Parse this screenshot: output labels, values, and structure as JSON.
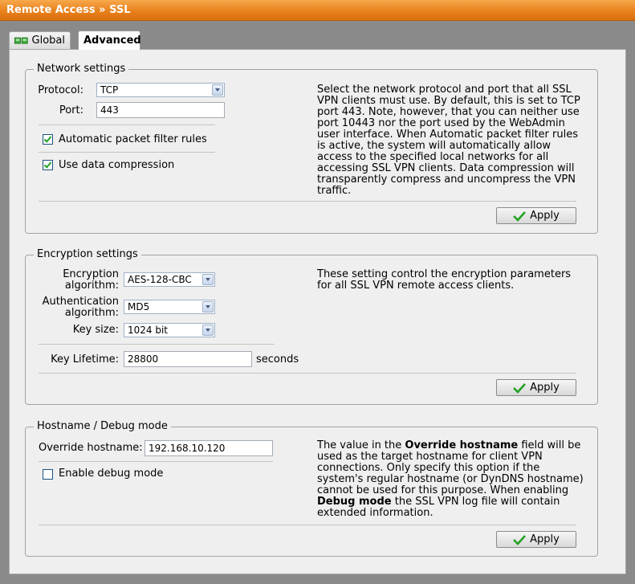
{
  "header": {
    "title": "Remote Access » SSL"
  },
  "tabs": [
    {
      "label": "Global",
      "icon": "network-icon",
      "active": false
    },
    {
      "label": "Advanced",
      "active": true
    }
  ],
  "network": {
    "legend": "Network settings",
    "protocol_label": "Protocol:",
    "protocol_value": "TCP",
    "port_label": "Port:",
    "port_value": "443",
    "auto_filter_label": "Automatic packet filter rules",
    "auto_filter_checked": true,
    "compression_label": "Use data compression",
    "compression_checked": true,
    "help_lines": [
      "Select the network protocol and port that all SSL",
      "VPN clients must use. By default, this is set to TCP",
      "port 443. Note, however, that you can neither use",
      "port 10443 nor the port used by the WebAdmin",
      "user interface. When Automatic packet filter rules",
      "is active, the system will automatically allow",
      "access to the specified local networks for all",
      "accessing SSL VPN clients. Data compression will",
      "transparently compress and uncompress the VPN",
      "traffic."
    ],
    "apply_label": "Apply"
  },
  "encryption": {
    "legend": "Encryption settings",
    "enc_label_line1": "Encryption",
    "enc_label_line2": "algorithm:",
    "enc_value": "AES-128-CBC",
    "auth_label_line1": "Authentication",
    "auth_label_line2": "algorithm:",
    "auth_value": "MD5",
    "keysize_label": "Key size:",
    "keysize_value": "1024 bit",
    "lifetime_label": "Key Lifetime:",
    "lifetime_value": "28800",
    "lifetime_unit": "seconds",
    "help_lines": [
      "These setting control the encryption parameters",
      "for all SSL VPN remote access clients."
    ],
    "apply_label": "Apply"
  },
  "hostname": {
    "legend": "Hostname / Debug mode",
    "override_label": "Override hostname:",
    "override_value": "192.168.10.120",
    "debug_label": "Enable debug mode",
    "debug_checked": false,
    "help": {
      "l1_pre": "The value in the ",
      "l1_bold": "Override hostname",
      "l1_post": " field will be",
      "l2": "used as the target hostname for client VPN",
      "l3": "connections. Only specify this option if the",
      "l4": "system's regular hostname (or DynDNS hostname)",
      "l5": "cannot be used for this purpose. When enabling",
      "l6_bold": "Debug mode",
      "l6_post": " the SSL VPN log file will contain",
      "l7": "extended information."
    },
    "apply_label": "Apply"
  },
  "colors": {
    "title_orange": "#e9811c",
    "check_green": "#21a121"
  }
}
